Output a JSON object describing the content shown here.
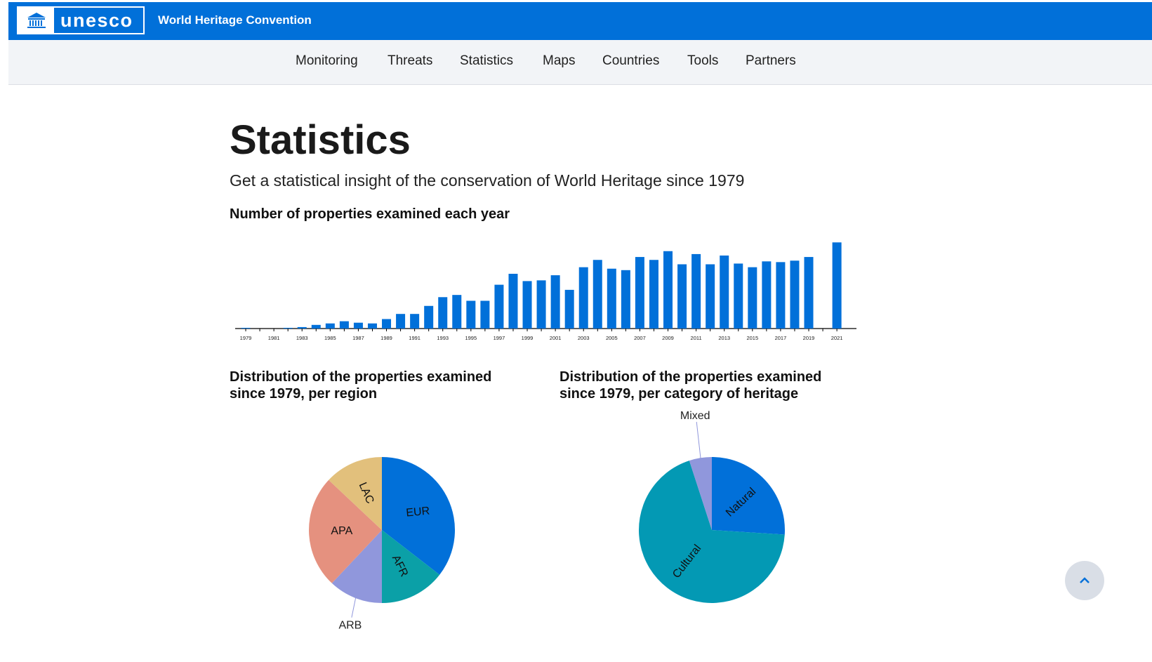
{
  "header": {
    "logo_text": "unesco",
    "site_name": "World Heritage Convention",
    "brand_color": "#0170d9"
  },
  "nav": {
    "items": [
      "Monitoring",
      "Threats",
      "Statistics",
      "Maps",
      "Countries",
      "Tools",
      "Partners"
    ]
  },
  "page": {
    "title": "Statistics",
    "subtitle": "Get a statistical insight of the conservation of World Heritage since 1979"
  },
  "sections": {
    "bar_title": "Number of properties examined each year",
    "region_title_line1": "Distribution of the properties examined",
    "region_title_line2": "since 1979, per region",
    "category_title_line1": "Distribution of the properties examined",
    "category_title_line2": "since 1979, per category of heritage"
  },
  "scroll_top_icon": "chevron-up-icon",
  "chart_data": [
    {
      "type": "bar",
      "categories": [
        "1979",
        "1980",
        "1981",
        "1982",
        "1983",
        "1984",
        "1985",
        "1986",
        "1987",
        "1988",
        "1989",
        "1990",
        "1991",
        "1992",
        "1993",
        "1994",
        "1995",
        "1996",
        "1997",
        "1998",
        "1999",
        "2000",
        "2001",
        "2002",
        "2003",
        "2004",
        "2005",
        "2006",
        "2007",
        "2008",
        "2009",
        "2010",
        "2011",
        "2012",
        "2013",
        "2014",
        "2015",
        "2016",
        "2017",
        "2018",
        "2019",
        "2020",
        "2021"
      ],
      "tick_labels": [
        "1979",
        "1981",
        "1983",
        "1985",
        "1987",
        "1989",
        "1991",
        "1993",
        "1995",
        "1997",
        "1999",
        "2001",
        "2003",
        "2005",
        "2007",
        "2009",
        "2011",
        "2013",
        "2015",
        "2017",
        "2019",
        "2021"
      ],
      "values": [
        1,
        0,
        0,
        1,
        2,
        5,
        7,
        10,
        8,
        7,
        13,
        20,
        20,
        31,
        43,
        46,
        38,
        38,
        60,
        75,
        65,
        66,
        73,
        53,
        84,
        94,
        82,
        80,
        98,
        94,
        106,
        88,
        102,
        88,
        100,
        89,
        84,
        92,
        91,
        93,
        98,
        0,
        118
      ],
      "ylim": [
        0,
        125
      ],
      "color": "#0170d9",
      "title": "Number of properties examined each year"
    },
    {
      "type": "pie",
      "title": "Distribution of the properties examined since 1979, per region",
      "labels": [
        "EUR",
        "AFR",
        "ARB",
        "APA",
        "LAC"
      ],
      "values": [
        35.5,
        14.5,
        12,
        25,
        13
      ],
      "colors": [
        "#0170d9",
        "#0ba0a7",
        "#9097dc",
        "#e5917f",
        "#e2c07c"
      ]
    },
    {
      "type": "pie",
      "title": "Distribution of the properties examined since 1979, per category of heritage",
      "labels": [
        "Natural",
        "Cultural",
        "Mixed"
      ],
      "values": [
        26,
        69,
        5
      ],
      "colors": [
        "#0170d9",
        "#0399b4",
        "#9097dc"
      ]
    }
  ]
}
